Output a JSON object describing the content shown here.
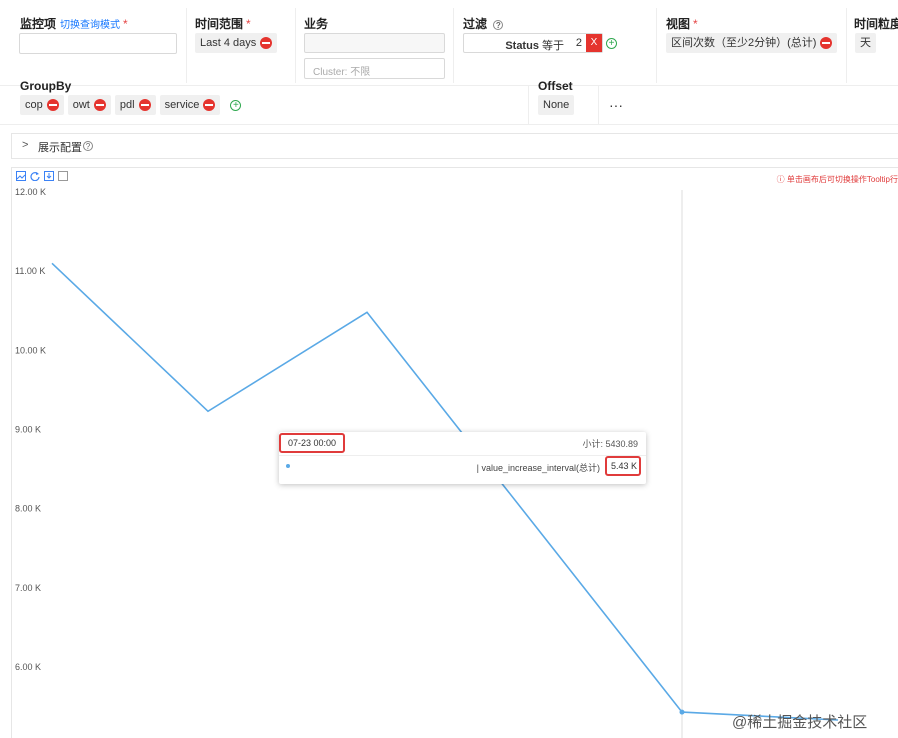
{
  "filters": {
    "monitor_label": "监控项",
    "switch_mode_link": "切换查询模式",
    "required_mark": "*",
    "time_range_label": "时间范围",
    "time_range_value": "Last 4 days",
    "business_label": "业务",
    "business_value": "",
    "cluster_placeholder": "Cluster: 不限",
    "filter_label": "过滤",
    "filter_field": "Status",
    "filter_op": "等于",
    "filter_value": "2",
    "filter_clear": "X",
    "view_label": "视图",
    "view_value": "区间次数（至少2分钟）(总计)",
    "granularity_label": "时间粒度",
    "granularity_value": "天",
    "groupby_label": "GroupBy",
    "groupby_tags": [
      "cop",
      "owt",
      "pdl",
      "service"
    ],
    "offset_label": "Offset",
    "offset_value": "None",
    "more": "···"
  },
  "display_config": {
    "label": "展示配置",
    "expand_icon": "chevron-right"
  },
  "chart_hint": "单击画布后可切换操作Tooltip行",
  "tooltip": {
    "time": "07-23 00:00",
    "subtotal": "小计: 5430.89",
    "series_name": "| value_increase_interval(总计)",
    "value": "5.43 K"
  },
  "watermark": "@稀土掘金技术社区",
  "colors": {
    "line": "#5aa9e6",
    "highlight": "#e03b3b",
    "link": "#1677ff",
    "remove": "#e5342e",
    "add": "#2fa84f"
  },
  "chart_data": {
    "type": "line",
    "series": [
      {
        "name": "value_increase_interval(总计)",
        "values": [
          11100,
          9230,
          10480,
          5430,
          5330
        ]
      }
    ],
    "y_ticks": [
      "12.00 K",
      "11.00 K",
      "10.00 K",
      "9.00 K",
      "8.00 K",
      "7.00 K",
      "6.00 K"
    ],
    "y_tick_values": [
      12000,
      11000,
      10000,
      9000,
      8000,
      7000,
      6000
    ]
  }
}
